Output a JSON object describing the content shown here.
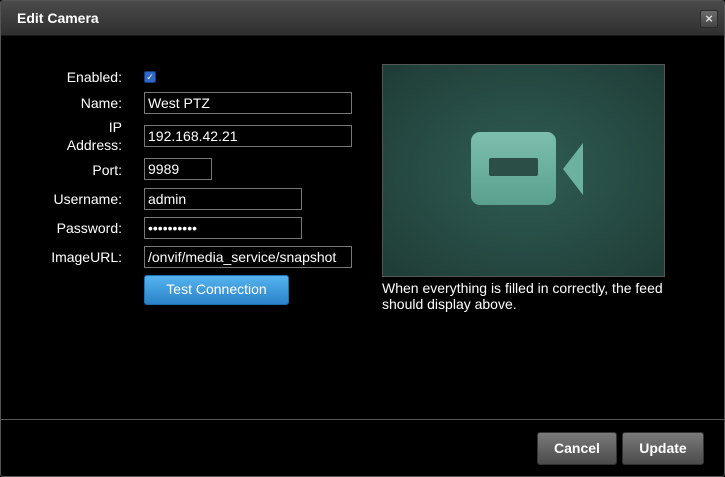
{
  "window": {
    "title": "Edit Camera",
    "close_symbol": "×"
  },
  "form": {
    "enabled_label": "Enabled:",
    "enabled_checked": true,
    "name_label": "Name:",
    "name_value": "West PTZ",
    "ip_label_line1": "IP",
    "ip_label_line2": "Address:",
    "ip_value": "192.168.42.21",
    "port_label": "Port:",
    "port_value": "9989",
    "username_label": "Username:",
    "username_value": "admin",
    "password_label": "Password:",
    "password_value": "••••••••••",
    "imageurl_label": "ImageURL:",
    "imageurl_value": "/onvif/media_service/snapshot",
    "test_button": "Test Connection"
  },
  "preview": {
    "icon": "video-camera-icon",
    "note": "When everything is filled in correctly, the feed should display above."
  },
  "footer": {
    "cancel": "Cancel",
    "update": "Update"
  },
  "colors": {
    "accent": "#3a97dc",
    "preview_bg": "#2a5048",
    "icon": "#6db2a0"
  }
}
